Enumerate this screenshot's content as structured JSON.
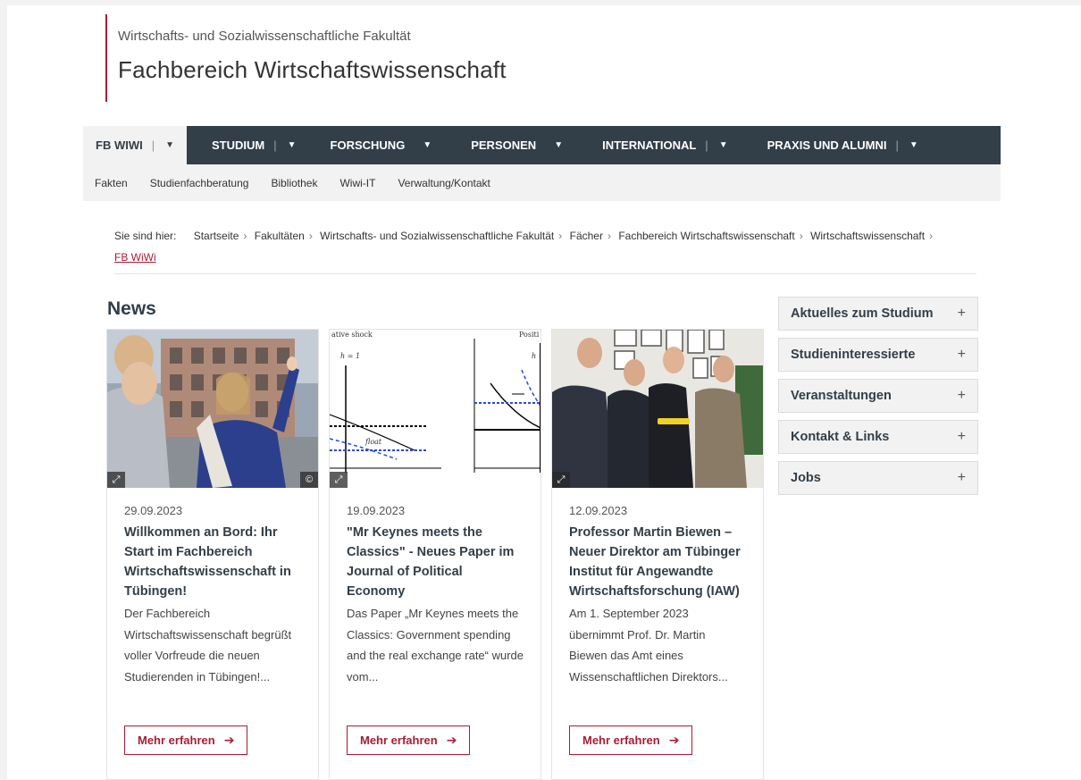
{
  "header": {
    "faculty": "Wirtschafts- und Sozialwissenschaftliche Fakultät",
    "department": "Fachbereich Wirtschaftswissenschaft"
  },
  "main_nav": {
    "items": [
      {
        "label": "FB WIWI",
        "active": true
      },
      {
        "label": "STUDIUM"
      },
      {
        "label": "FORSCHUNG"
      },
      {
        "label": "PERSONEN"
      },
      {
        "label": "INTERNATIONAL"
      },
      {
        "label": "PRAXIS UND ALUMNI"
      }
    ]
  },
  "sub_nav": {
    "items": [
      "Fakten",
      "Studienfachberatung",
      "Bibliothek",
      "Wiwi-IT",
      "Verwaltung/Kontakt"
    ]
  },
  "breadcrumb": {
    "lead": "Sie sind hier:",
    "items": [
      "Startseite",
      "Fakultäten",
      "Wirtschafts- und Sozialwissenschaftliche Fakultät",
      "Fächer",
      "Fachbereich Wirtschaftswissenschaft",
      "Wirtschaftswissenschaft"
    ],
    "current": "FB WiWi"
  },
  "news": {
    "title": "News",
    "more_label": "Mehr erfahren",
    "items": [
      {
        "date": "29.09.2023",
        "title": "Willkommen an Bord: Ihr Start im Fachbereich Wirtschaftswissenschaft in Tübingen!",
        "teaser": "Der Fachbereich Wirtschaftswissenschaft begrüßt voller Vorfreude die neuen Studierenden in Tübingen!..."
      },
      {
        "date": "19.09.2023",
        "title": "\"Mr Keynes meets the Classics\" - Neues Paper im Journal of Political Economy",
        "teaser": "Das Paper „Mr Keynes meets the Classics: Government spending and the real exchange rate“ wurde vom..."
      },
      {
        "date": "12.09.2023",
        "title": "Professor Martin Biewen – Neuer Direktor am Tübinger Institut für Angewandte Wirtschaftsforschung (IAW)",
        "teaser": "Am 1. September 2023 übernimmt Prof. Dr. Martin Biewen das Amt eines Wissenschaftlichen Direktors..."
      }
    ]
  },
  "sidebar": {
    "items": [
      "Aktuelles zum Studium",
      "Studieninteressierte",
      "Veranstaltungen",
      "Kontakt & Links",
      "Jobs"
    ]
  },
  "graph_labels": {
    "top_left": "ative shock",
    "top_right": "Positi",
    "h1": "h = 1",
    "h2": "h =",
    "float": "float"
  },
  "colors": {
    "brand": "#a51e37",
    "nav_bg": "#323e48",
    "subnav_bg": "#f2f2f2"
  }
}
